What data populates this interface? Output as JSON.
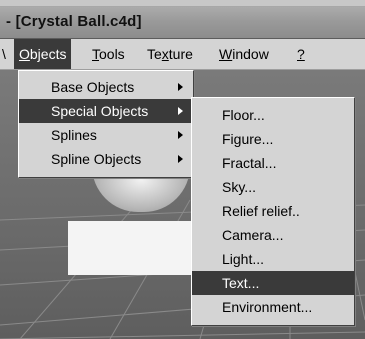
{
  "window": {
    "title": "- [Crystal Ball.c4d]"
  },
  "menubar": {
    "lead_fragment": "\\",
    "items": [
      {
        "label_u": "O",
        "label_rest": "bjects"
      },
      {
        "label_u": "T",
        "label_rest": "ools"
      },
      {
        "label_pre": "Te",
        "label_u": "x",
        "label_rest": "ture"
      },
      {
        "label_u": "W",
        "label_rest": "indow"
      },
      {
        "label_u": "?",
        "label_rest": ""
      }
    ]
  },
  "objects_menu": {
    "items": [
      {
        "label": "Base Objects",
        "has_submenu": true
      },
      {
        "label": "Special Objects",
        "has_submenu": true,
        "selected": true
      },
      {
        "label": "Splines",
        "has_submenu": true
      },
      {
        "label": "Spline Objects",
        "has_submenu": true
      }
    ]
  },
  "special_objects_menu": {
    "items": [
      {
        "label": "Floor..."
      },
      {
        "label": "Figure..."
      },
      {
        "label": "Fractal..."
      },
      {
        "label": "Sky..."
      },
      {
        "label": "Relief relief.."
      },
      {
        "label": "Camera..."
      },
      {
        "label": "Light..."
      },
      {
        "label": "Text...",
        "selected": true
      },
      {
        "label": "Environment..."
      }
    ]
  },
  "colors": {
    "menu_bg": "#d4d4d4",
    "selection_bg": "#3a3a3a",
    "selection_fg": "#ffffff"
  }
}
